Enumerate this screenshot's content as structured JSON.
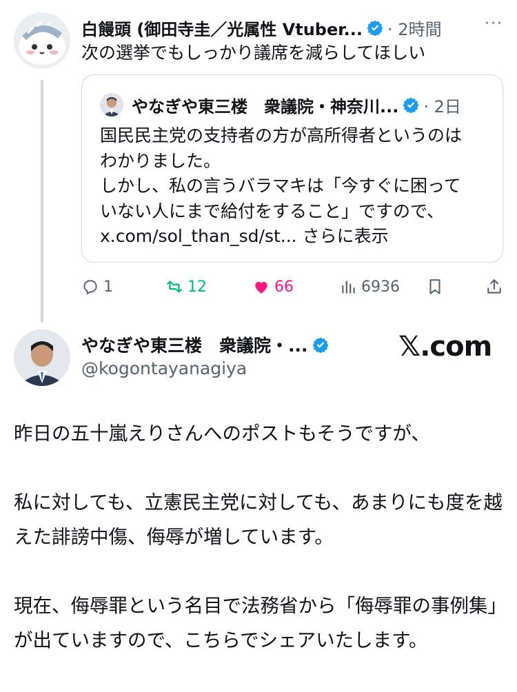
{
  "reply": {
    "author_name": "白饅頭 (御田寺圭／光属性 Vtuber...",
    "time": "· 2時間",
    "more": "···",
    "text": "次の選挙でもしっかり議席を減らしてほしい"
  },
  "quoted": {
    "author_name": "やなぎや東三楼　衆議院・神奈川...",
    "time": "· 2日",
    "lines": [
      "国民民主党の支持者の方が高所得者というのは",
      "わかりました。",
      "しかし、私の言うバラマキは「今すぐに困って",
      "いない人にまで給付をすること」ですので、"
    ],
    "link": "x.com/sol_than_sd/st...",
    "show_more": "さらに表示"
  },
  "actions": {
    "replies": "1",
    "reposts": "12",
    "likes": "66",
    "views": "6936",
    "colors": {
      "repost": "#00ba7c",
      "like": "#f91880",
      "muted": "#536471"
    }
  },
  "card": {
    "author_name": "やなぎや東三楼　衆議院・...",
    "handle": "@kogontayanagiya",
    "site": "𝕏.com",
    "paragraphs": [
      "昨日の五十嵐えりさんへのポストもそうですが、",
      "私に対しても、立憲民主党に対しても、あまりにも度を越えた誹謗中傷、侮辱が増しています。",
      "現在、侮辱罪という名目で法務省から「侮辱罪の事例集」が出ていますので、こちらでシェアいたします。"
    ]
  },
  "colors": {
    "verified": "#1d9bf0",
    "border": "#cfd9de",
    "text": "#0f1419"
  }
}
